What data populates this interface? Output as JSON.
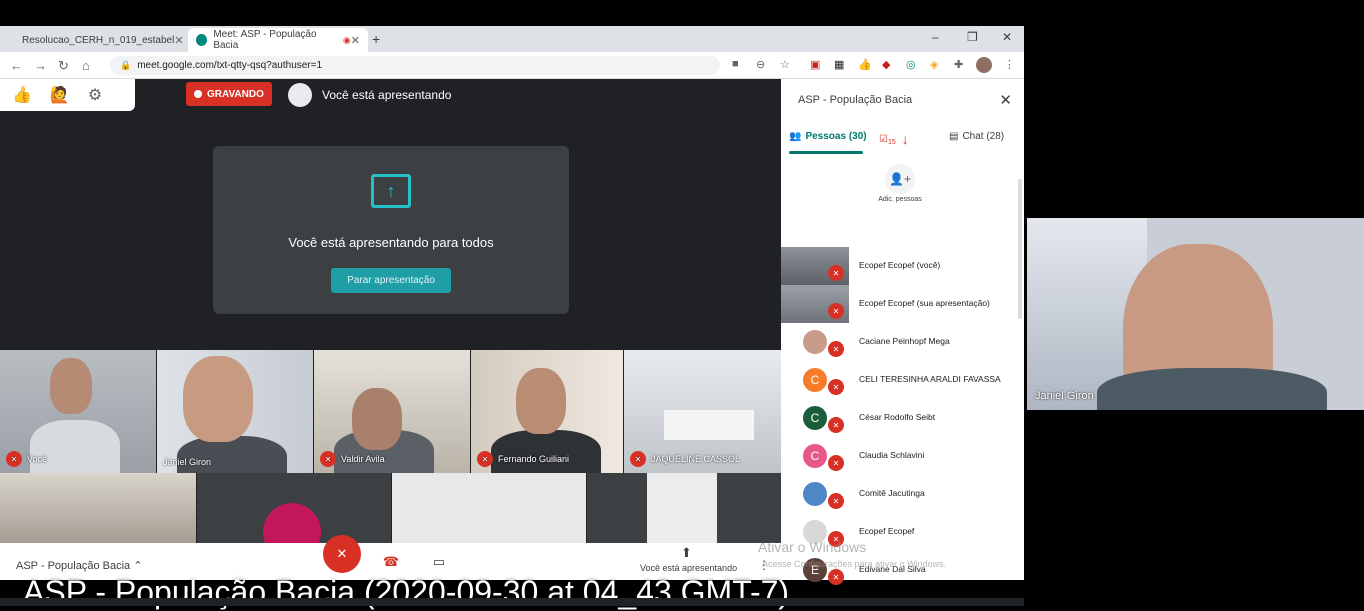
{
  "browser": {
    "tabs": [
      {
        "label": "Resolucao_CERH_n_019_estabel",
        "active": false
      },
      {
        "label": "Meet: ASP - População Bacia",
        "active": true
      }
    ],
    "url": "meet.google.com/txt-qtty-qsq?authuser=1",
    "window_controls": [
      "–",
      "❐",
      "✕"
    ]
  },
  "meet": {
    "recording_label": "GRAVANDO",
    "presenting_top": "Você está apresentando",
    "present_card": {
      "message": "Você está apresentando para todos",
      "stop_button": "Parar apresentação"
    },
    "tiles": [
      {
        "name": "Você"
      },
      {
        "name": "Janiel Giron"
      },
      {
        "name": "Valdir Avila"
      },
      {
        "name": "Fernando Guiliani"
      },
      {
        "name": "JAQUELINE CASSOL"
      }
    ],
    "bottom": {
      "meeting_name": "ASP - População Bacia",
      "presenting_label": "Você está apresentando"
    },
    "caption": "ASP - População Bacia (2020-09-30 at 04_43 GMT-7)"
  },
  "panel": {
    "title": "ASP - População Bacia",
    "tabs": {
      "people": "Pessoas (30)",
      "tasks_count": "15",
      "chat": "Chat (28)"
    },
    "add_people": "Adic. pessoas",
    "participants": [
      {
        "name": "Ecopef Ecopef (você)",
        "initial": "",
        "color": "#6b7077"
      },
      {
        "name": "Ecopef Ecopef (sua apresentação)",
        "initial": "",
        "color": "#7d8289"
      },
      {
        "name": "Caciane Peinhopf Mega",
        "initial": "",
        "color": "#c89b8a"
      },
      {
        "name": "CELI TERESINHA ARALDI FAVASSA",
        "initial": "C",
        "color": "#f57c28"
      },
      {
        "name": "César Rodolfo Seibt",
        "initial": "C",
        "color": "#1b5e3b"
      },
      {
        "name": "Claudia Schlavini",
        "initial": "C",
        "color": "#e8578a"
      },
      {
        "name": "Comitê Jacutinga",
        "initial": "",
        "color": "#4f86c6"
      },
      {
        "name": "Ecopef Ecopef",
        "initial": "",
        "color": "#d8d8d8"
      },
      {
        "name": "Edivane Dal Silva",
        "initial": "E",
        "color": "#5d4037"
      }
    ]
  },
  "watermark": {
    "line1": "Ativar o Windows",
    "line2": "Acesse Configurações para ativar o Windows."
  },
  "camera": {
    "name": "Janiel Giron"
  }
}
